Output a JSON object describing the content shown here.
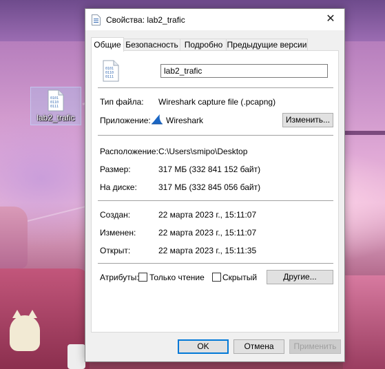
{
  "desktop": {
    "icon_label": "lab2_trafic"
  },
  "dialog": {
    "title": "Свойства: lab2_trafic",
    "close_glyph": "✕",
    "tabs": [
      "Общие",
      "Безопасность",
      "Подробно",
      "Предыдущие версии"
    ],
    "active_tab": "Общие",
    "general": {
      "file_name": "lab2_trafic",
      "file_type_label": "Тип файла:",
      "file_type_value": "Wireshark capture file (.pcapng)",
      "app_label": "Приложение:",
      "app_value": "Wireshark",
      "change_button": "Изменить...",
      "location_label": "Расположение:",
      "location_value": "C:\\Users\\smipo\\Desktop",
      "size_label": "Размер:",
      "size_value": "317 МБ (332 841 152 байт)",
      "ondisk_label": "На диске:",
      "ondisk_value": "317 МБ (332 845 056 байт)",
      "created_label": "Создан:",
      "created_value": "22 марта 2023 г., 15:11:07",
      "modified_label": "Изменен:",
      "modified_value": "22 марта 2023 г., 15:11:07",
      "accessed_label": "Открыт:",
      "accessed_value": "22 марта 2023 г., 15:11:35",
      "attributes_label": "Атрибуты:",
      "readonly_label": "Только чтение",
      "readonly_checked": false,
      "hidden_label": "Скрытый",
      "hidden_checked": false,
      "other_button": "Другие..."
    },
    "footer": {
      "ok": "OK",
      "cancel": "Отмена",
      "apply": "Применить"
    }
  },
  "colors": {
    "accent": "#0078d7",
    "dialog_bg": "#f0f0f0",
    "wireshark_fin": "#1a66c4"
  }
}
